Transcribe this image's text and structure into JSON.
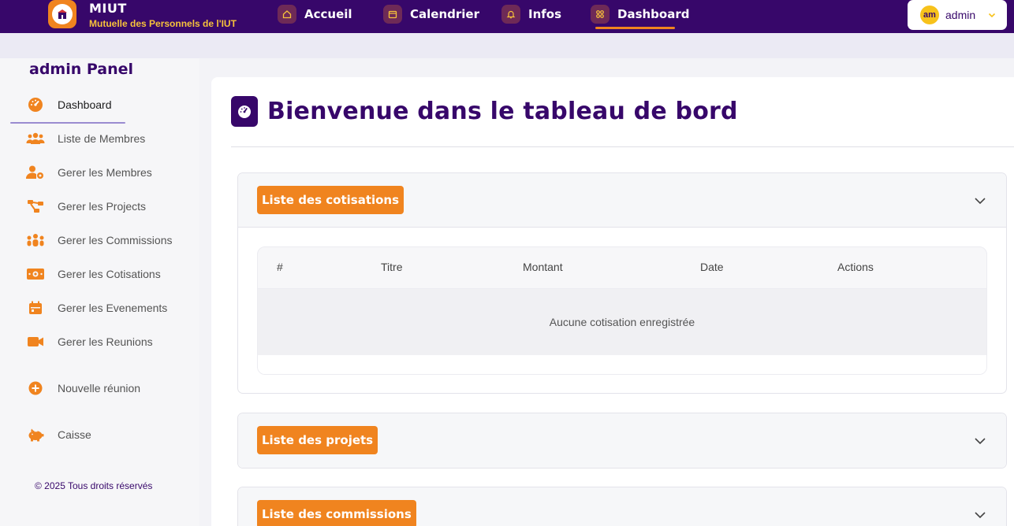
{
  "brand": {
    "name": "MIUT",
    "subtitle": "Mutuelle des Personnels de l'IUT"
  },
  "nav": {
    "items": [
      {
        "label": "Accueil",
        "icon": "home-icon"
      },
      {
        "label": "Calendrier",
        "icon": "calendar-icon"
      },
      {
        "label": "Infos",
        "icon": "bell-icon"
      },
      {
        "label": "Dashboard",
        "icon": "dashboard-icon",
        "active": true
      }
    ]
  },
  "user": {
    "initials": "am",
    "name": "admin"
  },
  "sidebar": {
    "title": "admin Panel",
    "items": [
      {
        "label": "Dashboard",
        "icon": "gauge-icon"
      },
      {
        "label": "Liste de Membres",
        "icon": "users-icon"
      },
      {
        "label": "Gerer les Membres",
        "icon": "user-cog-icon"
      },
      {
        "label": "Gerer les Projects",
        "icon": "project-diagram-icon"
      },
      {
        "label": "Gerer les Commissions",
        "icon": "people-group-icon"
      },
      {
        "label": "Gerer les Cotisations",
        "icon": "money-bill-icon"
      },
      {
        "label": "Gerer les Evenements",
        "icon": "calendar-icon"
      },
      {
        "label": "Gerer les Reunions",
        "icon": "video-icon"
      },
      {
        "label": "Nouvelle réunion",
        "icon": "plus-circle-icon"
      },
      {
        "label": "Caisse",
        "icon": "piggy-bank-icon"
      }
    ],
    "copyright": "© 2025 Tous droits réservés"
  },
  "main": {
    "title": "Bienvenue dans le tableau de bord",
    "sections": [
      {
        "label": "Liste des cotisations",
        "expanded": true,
        "columns": [
          "#",
          "Titre",
          "Montant",
          "Date",
          "Actions"
        ],
        "empty_text": "Aucune cotisation enregistrée"
      },
      {
        "label": "Liste des projets",
        "expanded": false
      },
      {
        "label": "Liste des commissions",
        "expanded": false
      }
    ]
  },
  "colors": {
    "primary": "#37076a",
    "accent": "#f0841f",
    "avatar": "#f7c21b"
  }
}
